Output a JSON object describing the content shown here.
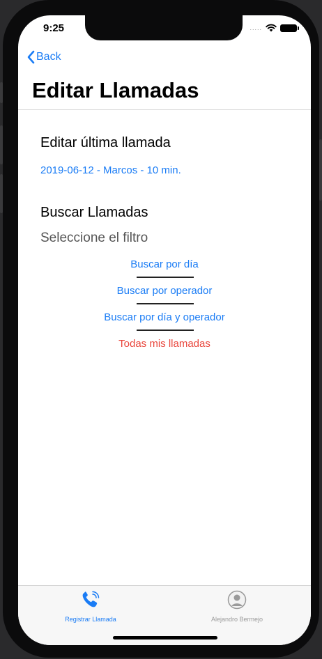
{
  "status_bar": {
    "time": "9:25",
    "signal": "....."
  },
  "nav": {
    "back_label": "Back",
    "title": "Editar Llamadas"
  },
  "edit_section": {
    "title": "Editar última llamada",
    "last_call": "2019-06-12 - Marcos - 10 min."
  },
  "search_section": {
    "title": "Buscar Llamadas",
    "hint": "Seleccione el filtro",
    "options": [
      {
        "label": "Buscar por día"
      },
      {
        "label": "Buscar por operador"
      },
      {
        "label": "Buscar por día y operador"
      },
      {
        "label": "Todas mis llamadas"
      }
    ]
  },
  "tabbar": {
    "tabs": [
      {
        "label": "Registrar Llamada",
        "icon": "phone-icon",
        "active": true
      },
      {
        "label": "Alejandro Bermejo",
        "icon": "user-icon",
        "active": false
      }
    ]
  },
  "colors": {
    "accent": "#1a7cf5",
    "destructive": "#e9463c",
    "tab_inactive": "#9a9a9a"
  }
}
